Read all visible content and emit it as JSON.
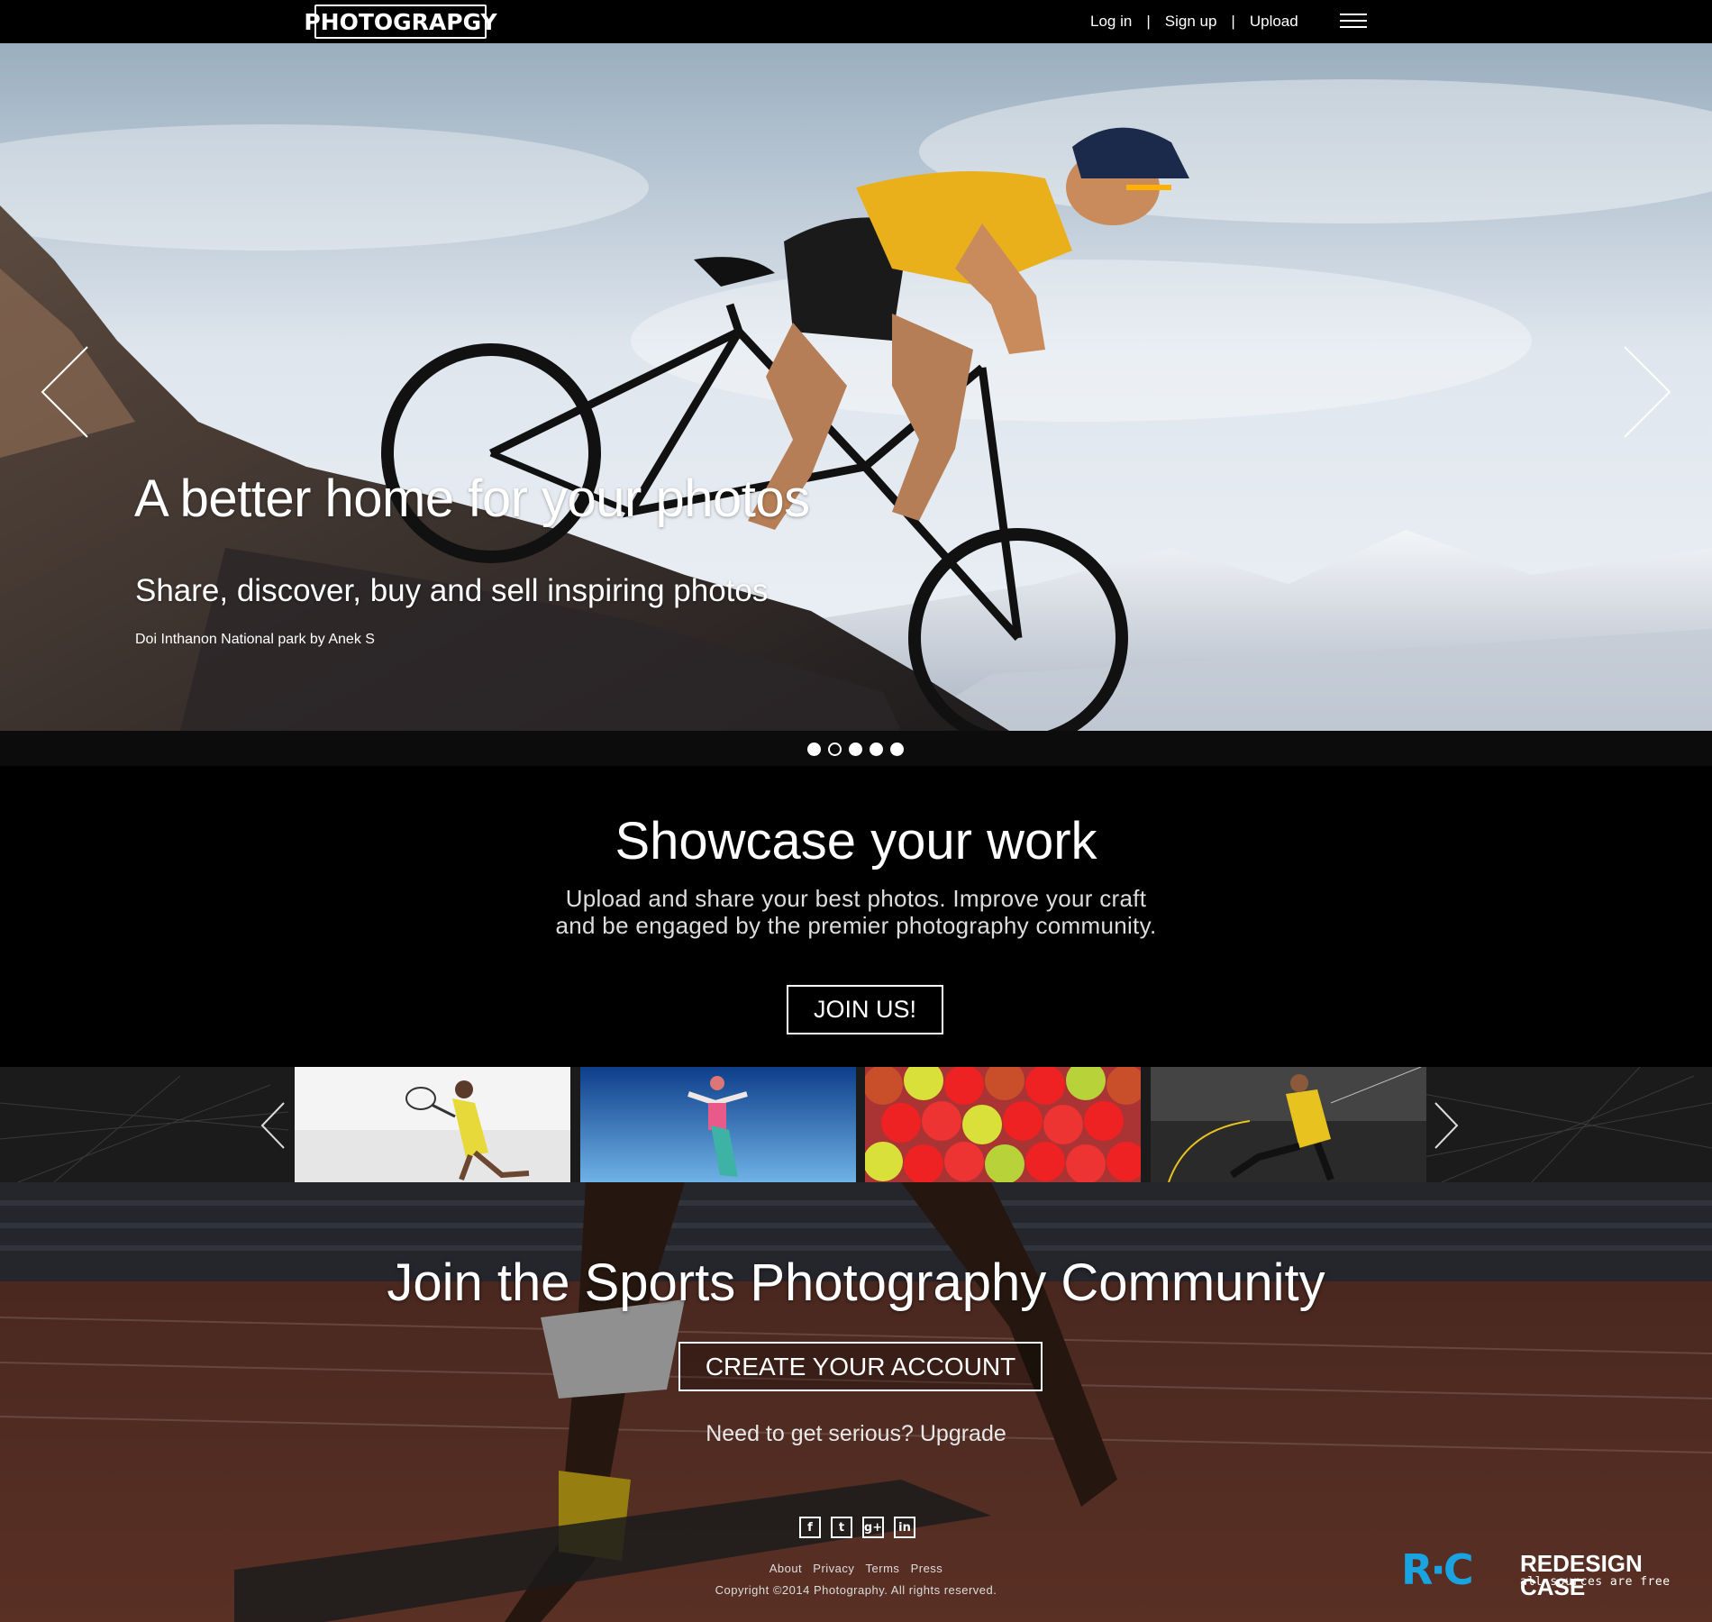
{
  "nav": {
    "logo": "PHOTOGRAPGY",
    "login": "Log in",
    "separator": "|",
    "signup": "Sign up",
    "upload": "Upload",
    "menu_icon": "hamburger-menu-icon"
  },
  "hero": {
    "title": "A better home for your photos",
    "subtitle": "Share, discover, buy and sell inspiring photos",
    "credit": "Doi Inthanon National park by Anek S",
    "slide_count": 5,
    "active_slide": 2,
    "prev_icon": "chevron-left-icon",
    "next_icon": "chevron-right-icon"
  },
  "showcase": {
    "title": "Showcase your work",
    "text_line1": "Upload and share your best photos. Improve your craft",
    "text_line2": "and be engaged by the premier photography community.",
    "button": "JOIN US!"
  },
  "thumbnails": [
    {
      "subject": "tennis player in yellow"
    },
    {
      "subject": "skydiver with snowboard"
    },
    {
      "subject": "pile of colorful balls"
    },
    {
      "subject": "soccer player kicking"
    }
  ],
  "cta": {
    "title": "Join the Sports Photography Community",
    "button": "CREATE YOUR ACCOUNT",
    "upgrade_prefix": "Need to get serious?",
    "upgrade_link": "Upgrade"
  },
  "footer": {
    "socials": [
      {
        "icon": "facebook-icon",
        "glyph": "f"
      },
      {
        "icon": "twitter-icon",
        "glyph": "t"
      },
      {
        "icon": "google-plus-icon",
        "glyph": "g+"
      },
      {
        "icon": "linkedin-icon",
        "glyph": "in"
      }
    ],
    "links": [
      "About",
      "Privacy",
      "Terms",
      "Press"
    ],
    "copyright": "Copyright ©2014 Photography. All rights reserved."
  },
  "badge": {
    "mark": "R·C",
    "name": "REDESIGN CASE",
    "tagline": "all sources are free"
  },
  "colors": {
    "background": "#000000",
    "text": "#ffffff",
    "badge_accent": "#19a3e0"
  }
}
